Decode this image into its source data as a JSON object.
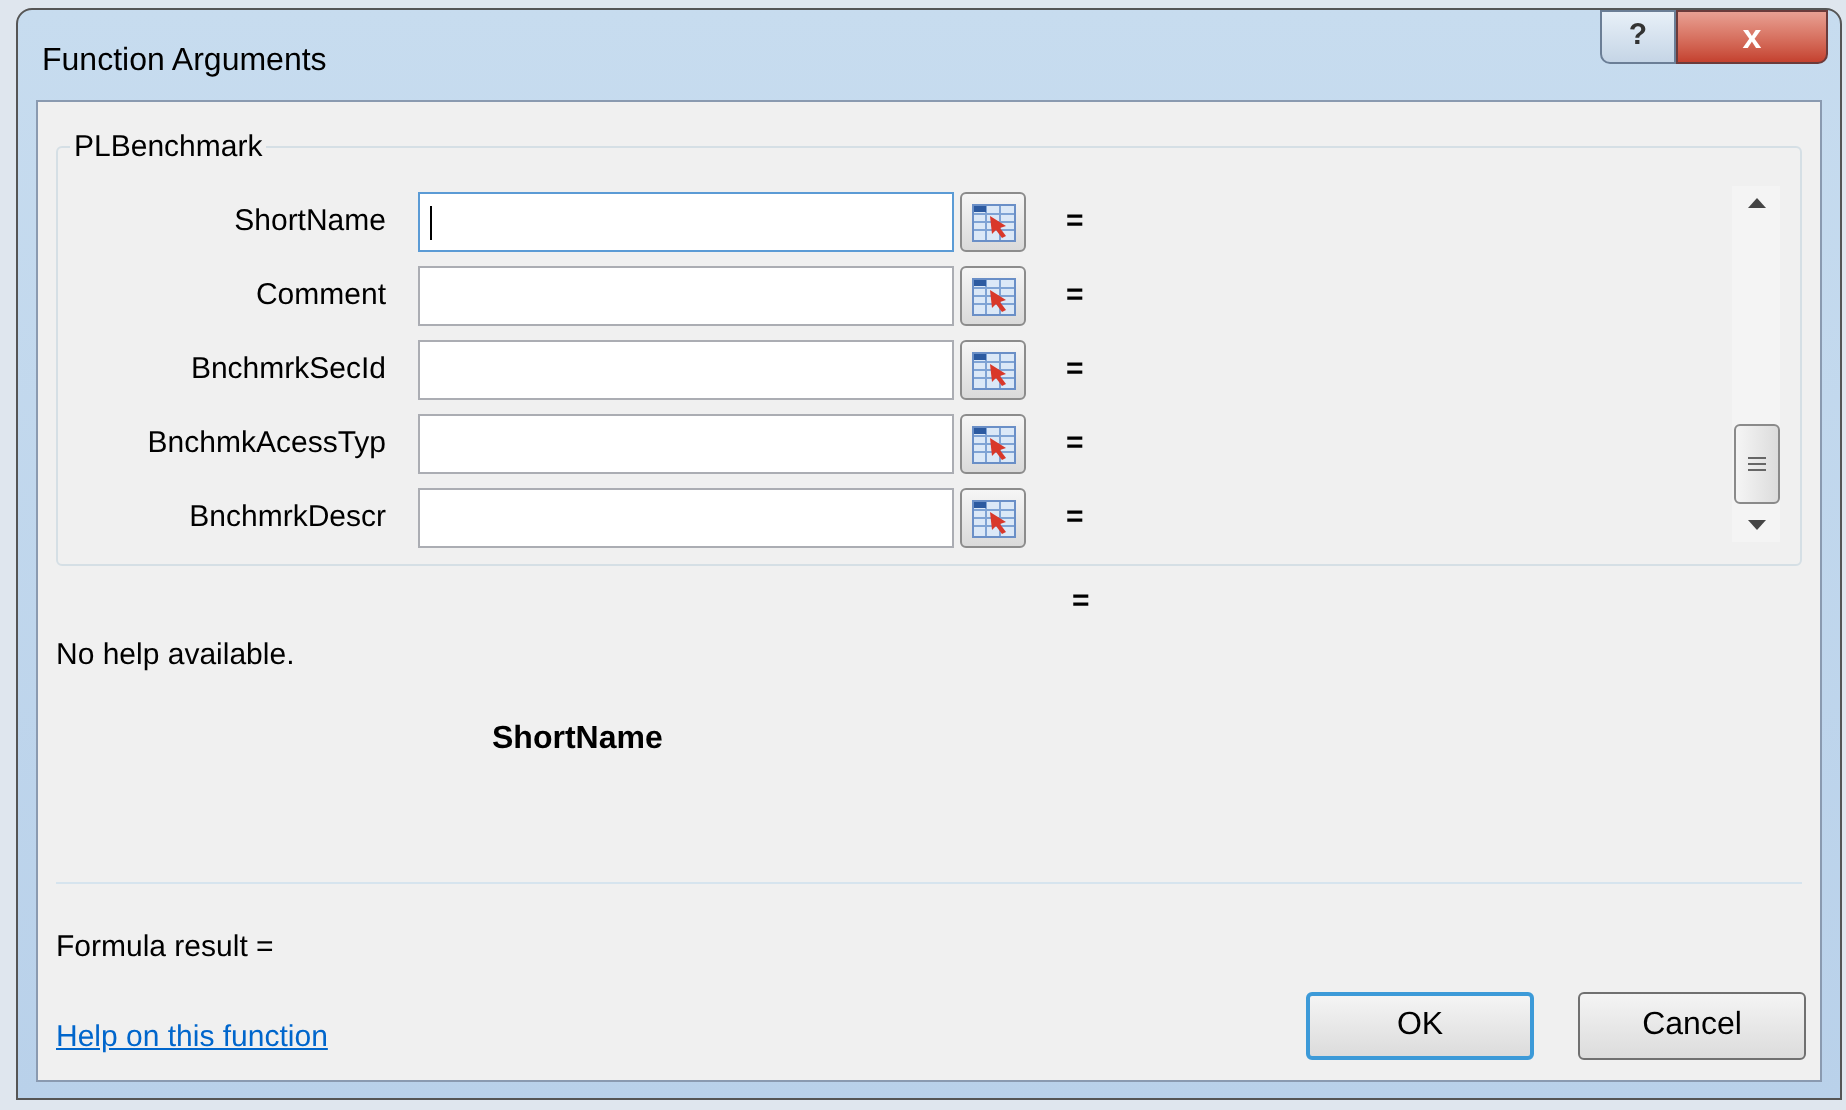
{
  "window": {
    "title": "Function Arguments",
    "help_button": "?",
    "close_button": "x"
  },
  "function_group": {
    "title": "PLBenchmark",
    "arguments": [
      {
        "label": "ShortName",
        "focused": true,
        "equals": "="
      },
      {
        "label": "Comment",
        "focused": false,
        "equals": "="
      },
      {
        "label": "BnchmrkSecId",
        "focused": false,
        "equals": "="
      },
      {
        "label": "BnchmkAcessTyp",
        "focused": false,
        "equals": "="
      },
      {
        "label": "BnchmrkDescr",
        "focused": false,
        "equals": "="
      }
    ]
  },
  "function_result": "=",
  "help_text": "No help available.",
  "argument_name": "ShortName",
  "formula_result": "Formula result =",
  "help_link": "Help on this function",
  "buttons": [
    {
      "label": "OK",
      "default": true
    },
    {
      "label": "Cancel",
      "default": false
    }
  ]
}
